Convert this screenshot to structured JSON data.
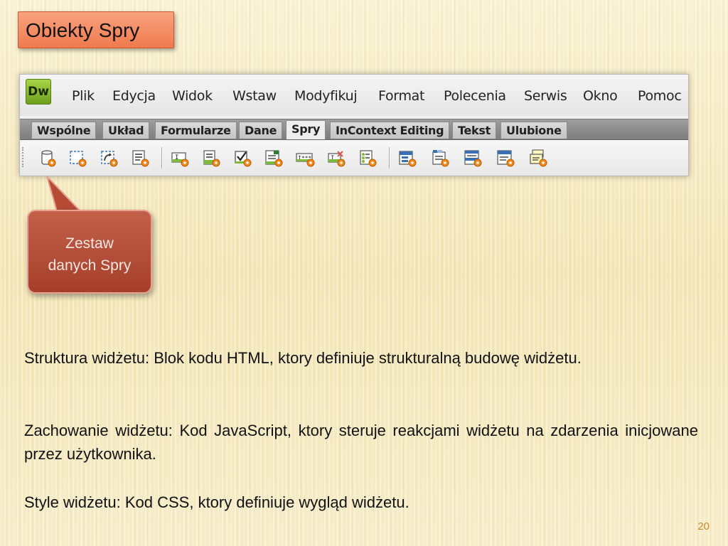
{
  "slide": {
    "title": "Obiekty Spry",
    "page_number": "20"
  },
  "app": {
    "logo_text": "Dw",
    "menu": [
      "Plik",
      "Edycja",
      "Widok",
      "Wstaw",
      "Modyfikuj",
      "Format",
      "Polecenia",
      "Serwis",
      "Okno",
      "Pomoc"
    ],
    "tabs": [
      "Wspólne",
      "Układ",
      "Formularze",
      "Dane",
      "Spry",
      "InContext Editing",
      "Tekst",
      "Ulubione"
    ],
    "active_tab": "Spry",
    "toolbar_icons": [
      "spry-data-set-icon",
      "spry-region-icon",
      "spry-repeat-icon",
      "spry-repeat-list-icon",
      "spry-validation-text-field-icon",
      "spry-validation-select-icon",
      "spry-validation-checkbox-icon",
      "spry-validation-textarea-icon",
      "spry-validation-password-icon",
      "spry-validation-confirm-icon",
      "spry-validation-radio-group-icon",
      "spry-menu-bar-icon",
      "spry-tabbed-panels-icon",
      "spry-accordion-icon",
      "spry-collapsible-panel-icon",
      "spry-tooltip-icon"
    ]
  },
  "callout": {
    "line1": "Zestaw",
    "line2": "danych Spry"
  },
  "paragraphs": [
    {
      "lead": "Struktura widżetu:",
      "text": " Blok kodu HTML, ktory definiuje strukturalną budowę widżetu."
    },
    {
      "lead": "Zachowanie widżetu:",
      "text": " Kod JavaScript, ktory steruje reakcjami widżetu na zdarzenia inicjowane przez użytkownika."
    },
    {
      "lead": "Style widżetu:",
      "text": " Kod CSS, ktory definiuje wygląd widżetu."
    }
  ],
  "colors": {
    "title_box": "#f07a4e",
    "callout": "#a53f2b",
    "page_number": "#c98a2e",
    "gear_badge": "#f08a1c"
  }
}
